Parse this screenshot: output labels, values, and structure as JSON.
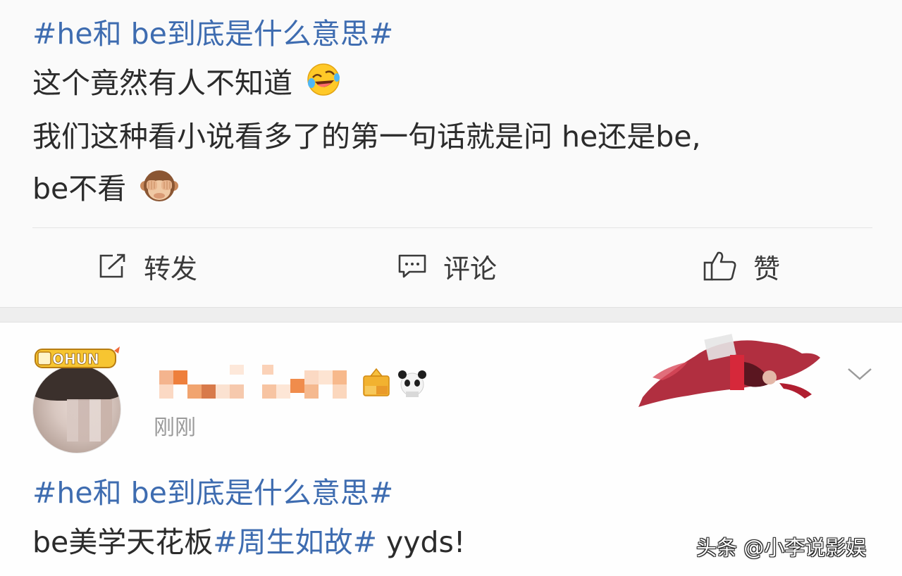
{
  "colors": {
    "topic_blue": "#3e6cb0",
    "body_text": "#2b2b2b",
    "timestamp_gray": "#9a9a9a",
    "divider": "#e4e4e4",
    "section_gap": "#eeeeee"
  },
  "post1": {
    "topic": "#he和 be到底是什么意思#",
    "line1": "这个竟然有人不知道",
    "line1_emoji": "laughing-crying-emoji",
    "line2": "我们这种看小说看多了的第一句话就是问 he还是be,",
    "line3": "be不看",
    "line3_emoji": "see-no-evil-monkey-emoji",
    "actions": {
      "forward_label": "转发",
      "forward_icon": "share-icon",
      "comment_label": "评论",
      "comment_icon": "comment-icon",
      "like_label": "赞",
      "like_icon": "thumbs-up-icon"
    }
  },
  "post2": {
    "badge_text": "OHUN",
    "timestamp": "刚刚",
    "topic": "#he和 be到底是什么意思#",
    "line1_prefix": "be美学天花板",
    "line1_hashtag": "#周生如故#",
    "line1_suffix": " yyds!",
    "menu_icon": "chevron-down-icon"
  },
  "watermark": "头条 @小李说影娱"
}
